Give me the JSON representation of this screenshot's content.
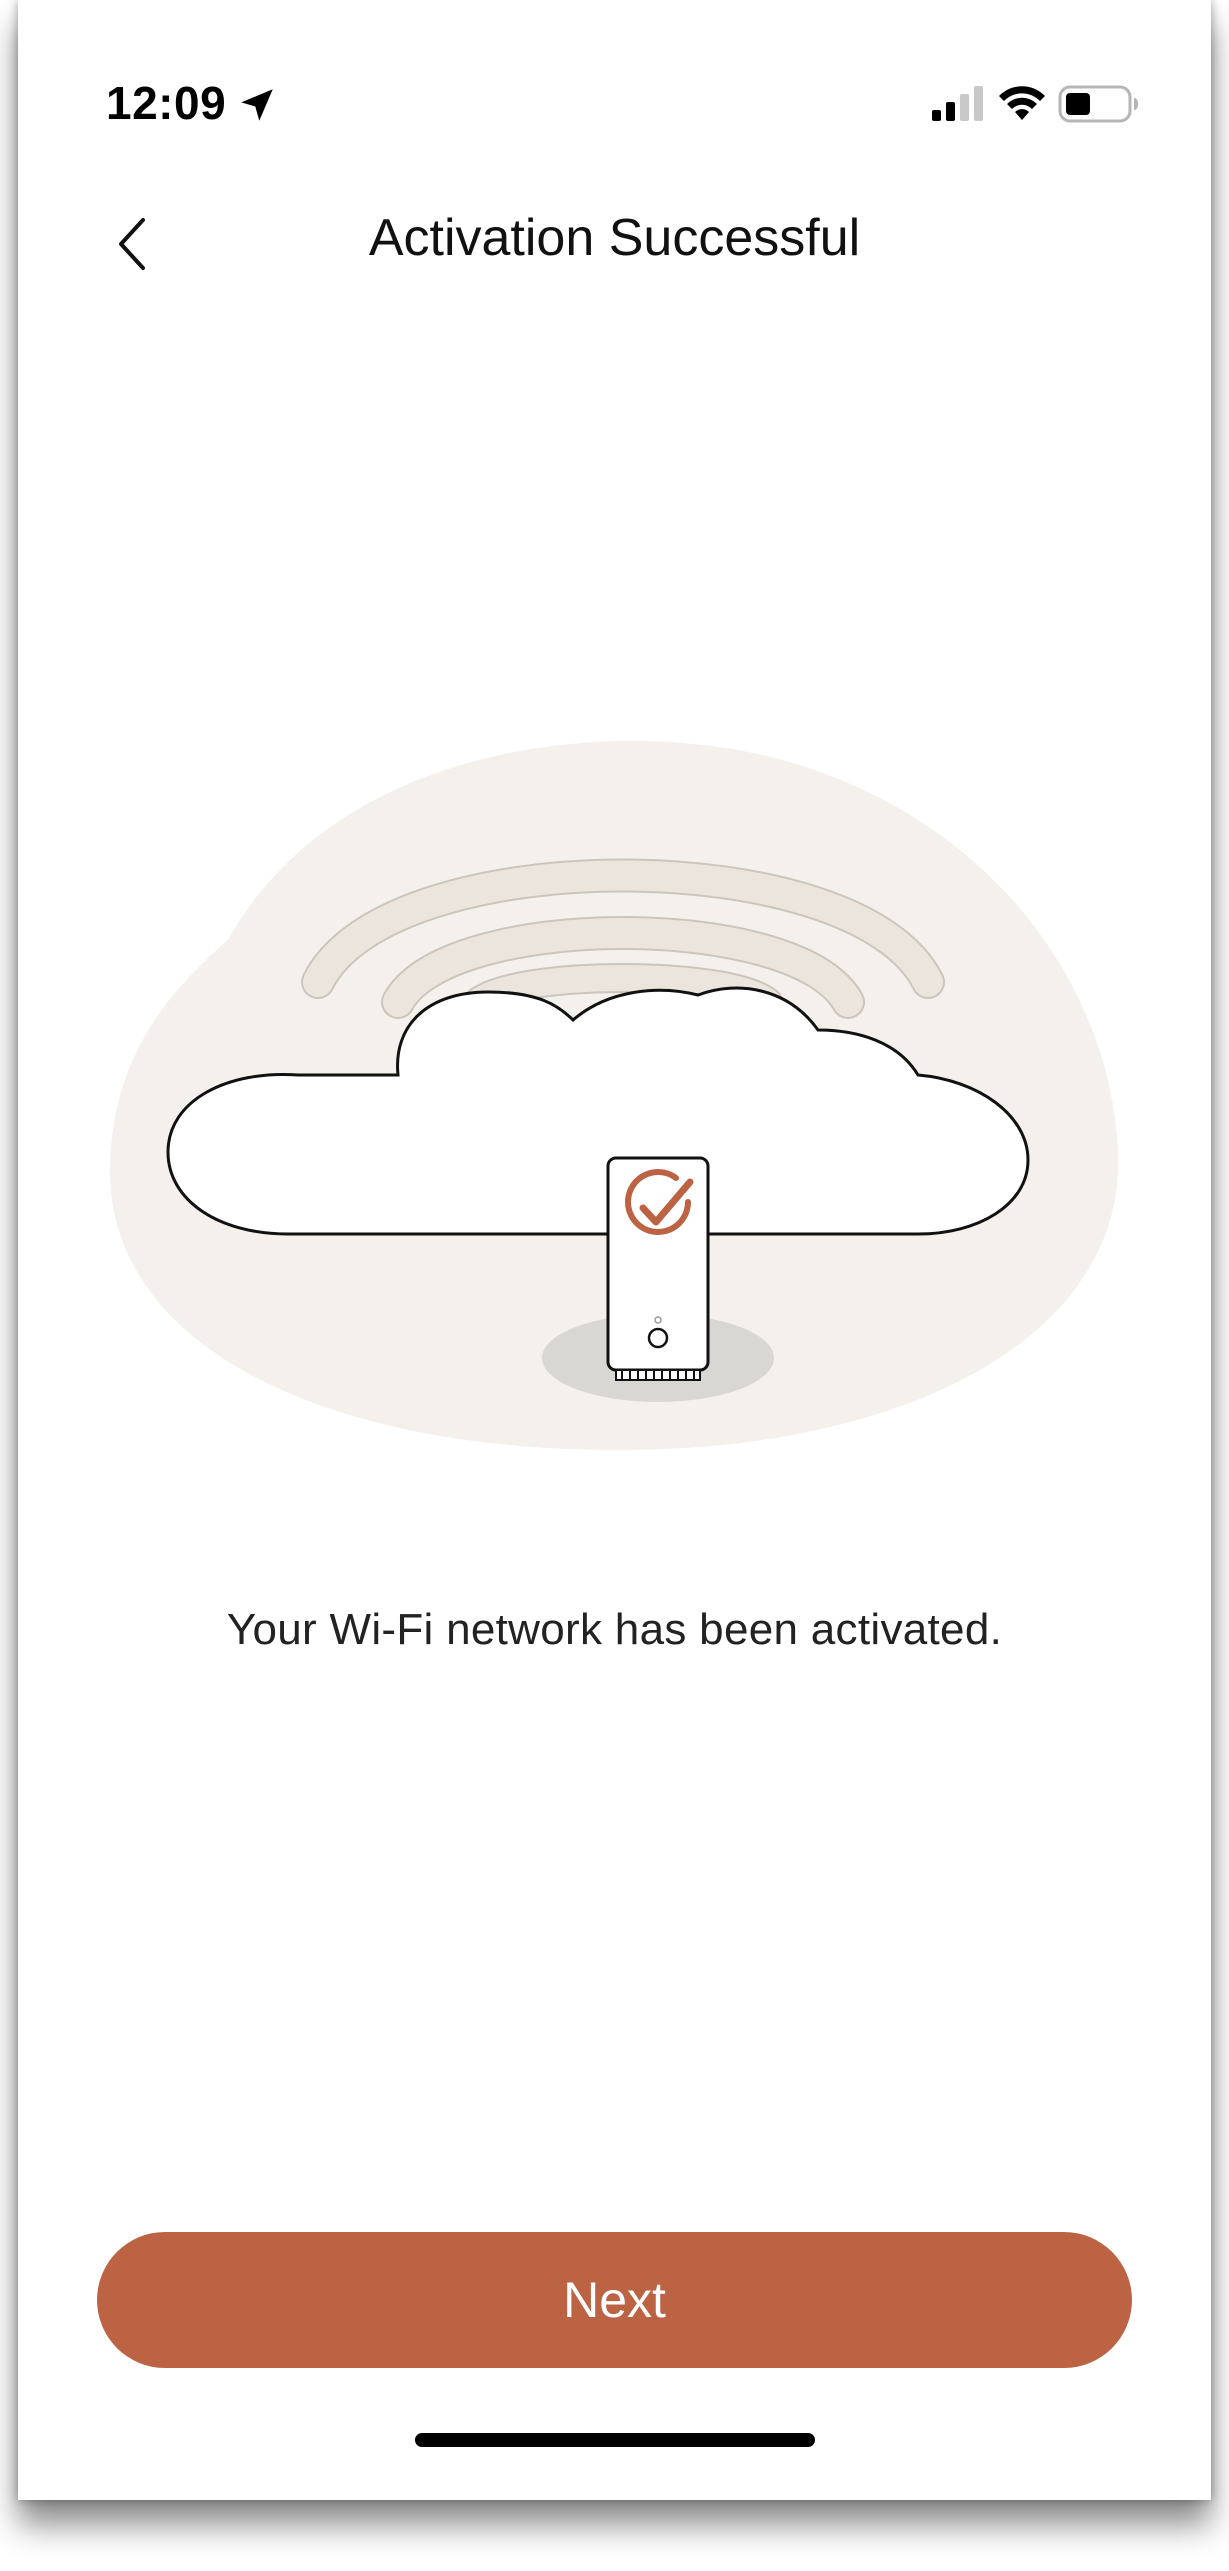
{
  "status_bar": {
    "time": "12:09",
    "icons": [
      "location-arrow-icon",
      "cellular-signal-icon",
      "wifi-icon",
      "battery-icon"
    ]
  },
  "nav": {
    "title": "Activation Successful",
    "back_icon": "chevron-left-icon"
  },
  "illustration": {
    "name": "router-cloud-activated-illustration",
    "device_badge_icon": "check-circle-icon"
  },
  "main": {
    "message": "Your Wi-Fi network has been activated."
  },
  "footer": {
    "next_label": "Next"
  },
  "colors": {
    "accent": "#bc6344",
    "blob": "#f4f1ec",
    "wave": "#ece5dd",
    "shadow": "#d9d7d4"
  }
}
